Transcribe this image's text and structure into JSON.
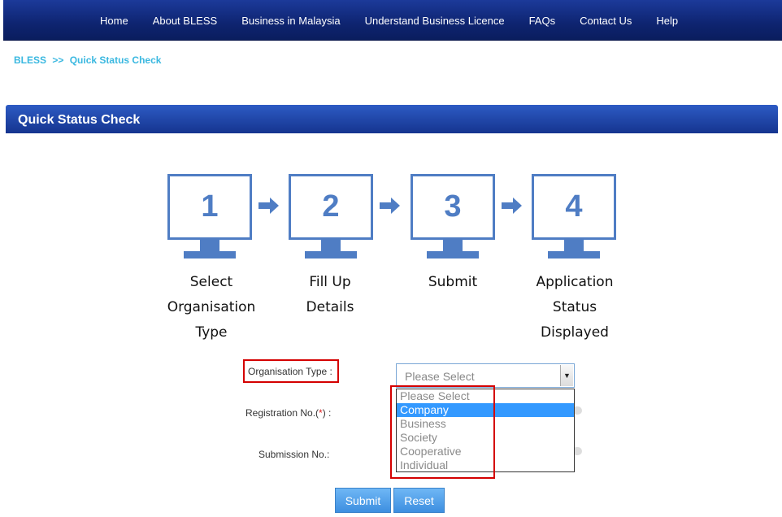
{
  "nav": {
    "items": [
      {
        "label": "Home"
      },
      {
        "label": "About BLESS"
      },
      {
        "label": "Business in Malaysia"
      },
      {
        "label": "Understand Business Licence"
      },
      {
        "label": "FAQs"
      },
      {
        "label": "Contact Us"
      },
      {
        "label": "Help"
      }
    ]
  },
  "breadcrumb": {
    "root": "BLESS",
    "separator": ">>",
    "current": "Quick Status Check"
  },
  "section": {
    "title": "Quick Status Check"
  },
  "steps": [
    {
      "number": "1",
      "label_lines": [
        "Select",
        "Organisation",
        "Type"
      ]
    },
    {
      "number": "2",
      "label_lines": [
        "Fill Up",
        "Details"
      ]
    },
    {
      "number": "3",
      "label_lines": [
        "Submit"
      ]
    },
    {
      "number": "4",
      "label_lines": [
        "Application",
        "Status",
        "Displayed"
      ]
    }
  ],
  "form": {
    "org_type_label": "Organisation Type :",
    "reg_no_label_prefix": "Registration No.(",
    "reg_no_required": "*",
    "reg_no_label_suffix": ") :",
    "submission_label": "Submission No.:",
    "select_value": "Please Select",
    "options": [
      {
        "label": "Please Select",
        "selected": false
      },
      {
        "label": "Company",
        "selected": true
      },
      {
        "label": "Business",
        "selected": false
      },
      {
        "label": "Society",
        "selected": false
      },
      {
        "label": "Cooperative",
        "selected": false
      },
      {
        "label": "Individual",
        "selected": false
      }
    ],
    "submit_label": "Submit",
    "reset_label": "Reset"
  },
  "colors": {
    "nav_bg": "#0e2470",
    "accent_blue": "#4f7dc4",
    "breadcrumb": "#3ab8e0",
    "highlight_red": "#d40000",
    "selected_option": "#3399ff"
  },
  "icons": {
    "step_monitor": "monitor-icon",
    "step_arrow": "arrow-right-icon",
    "select_toggle": "chevron-down-icon"
  }
}
